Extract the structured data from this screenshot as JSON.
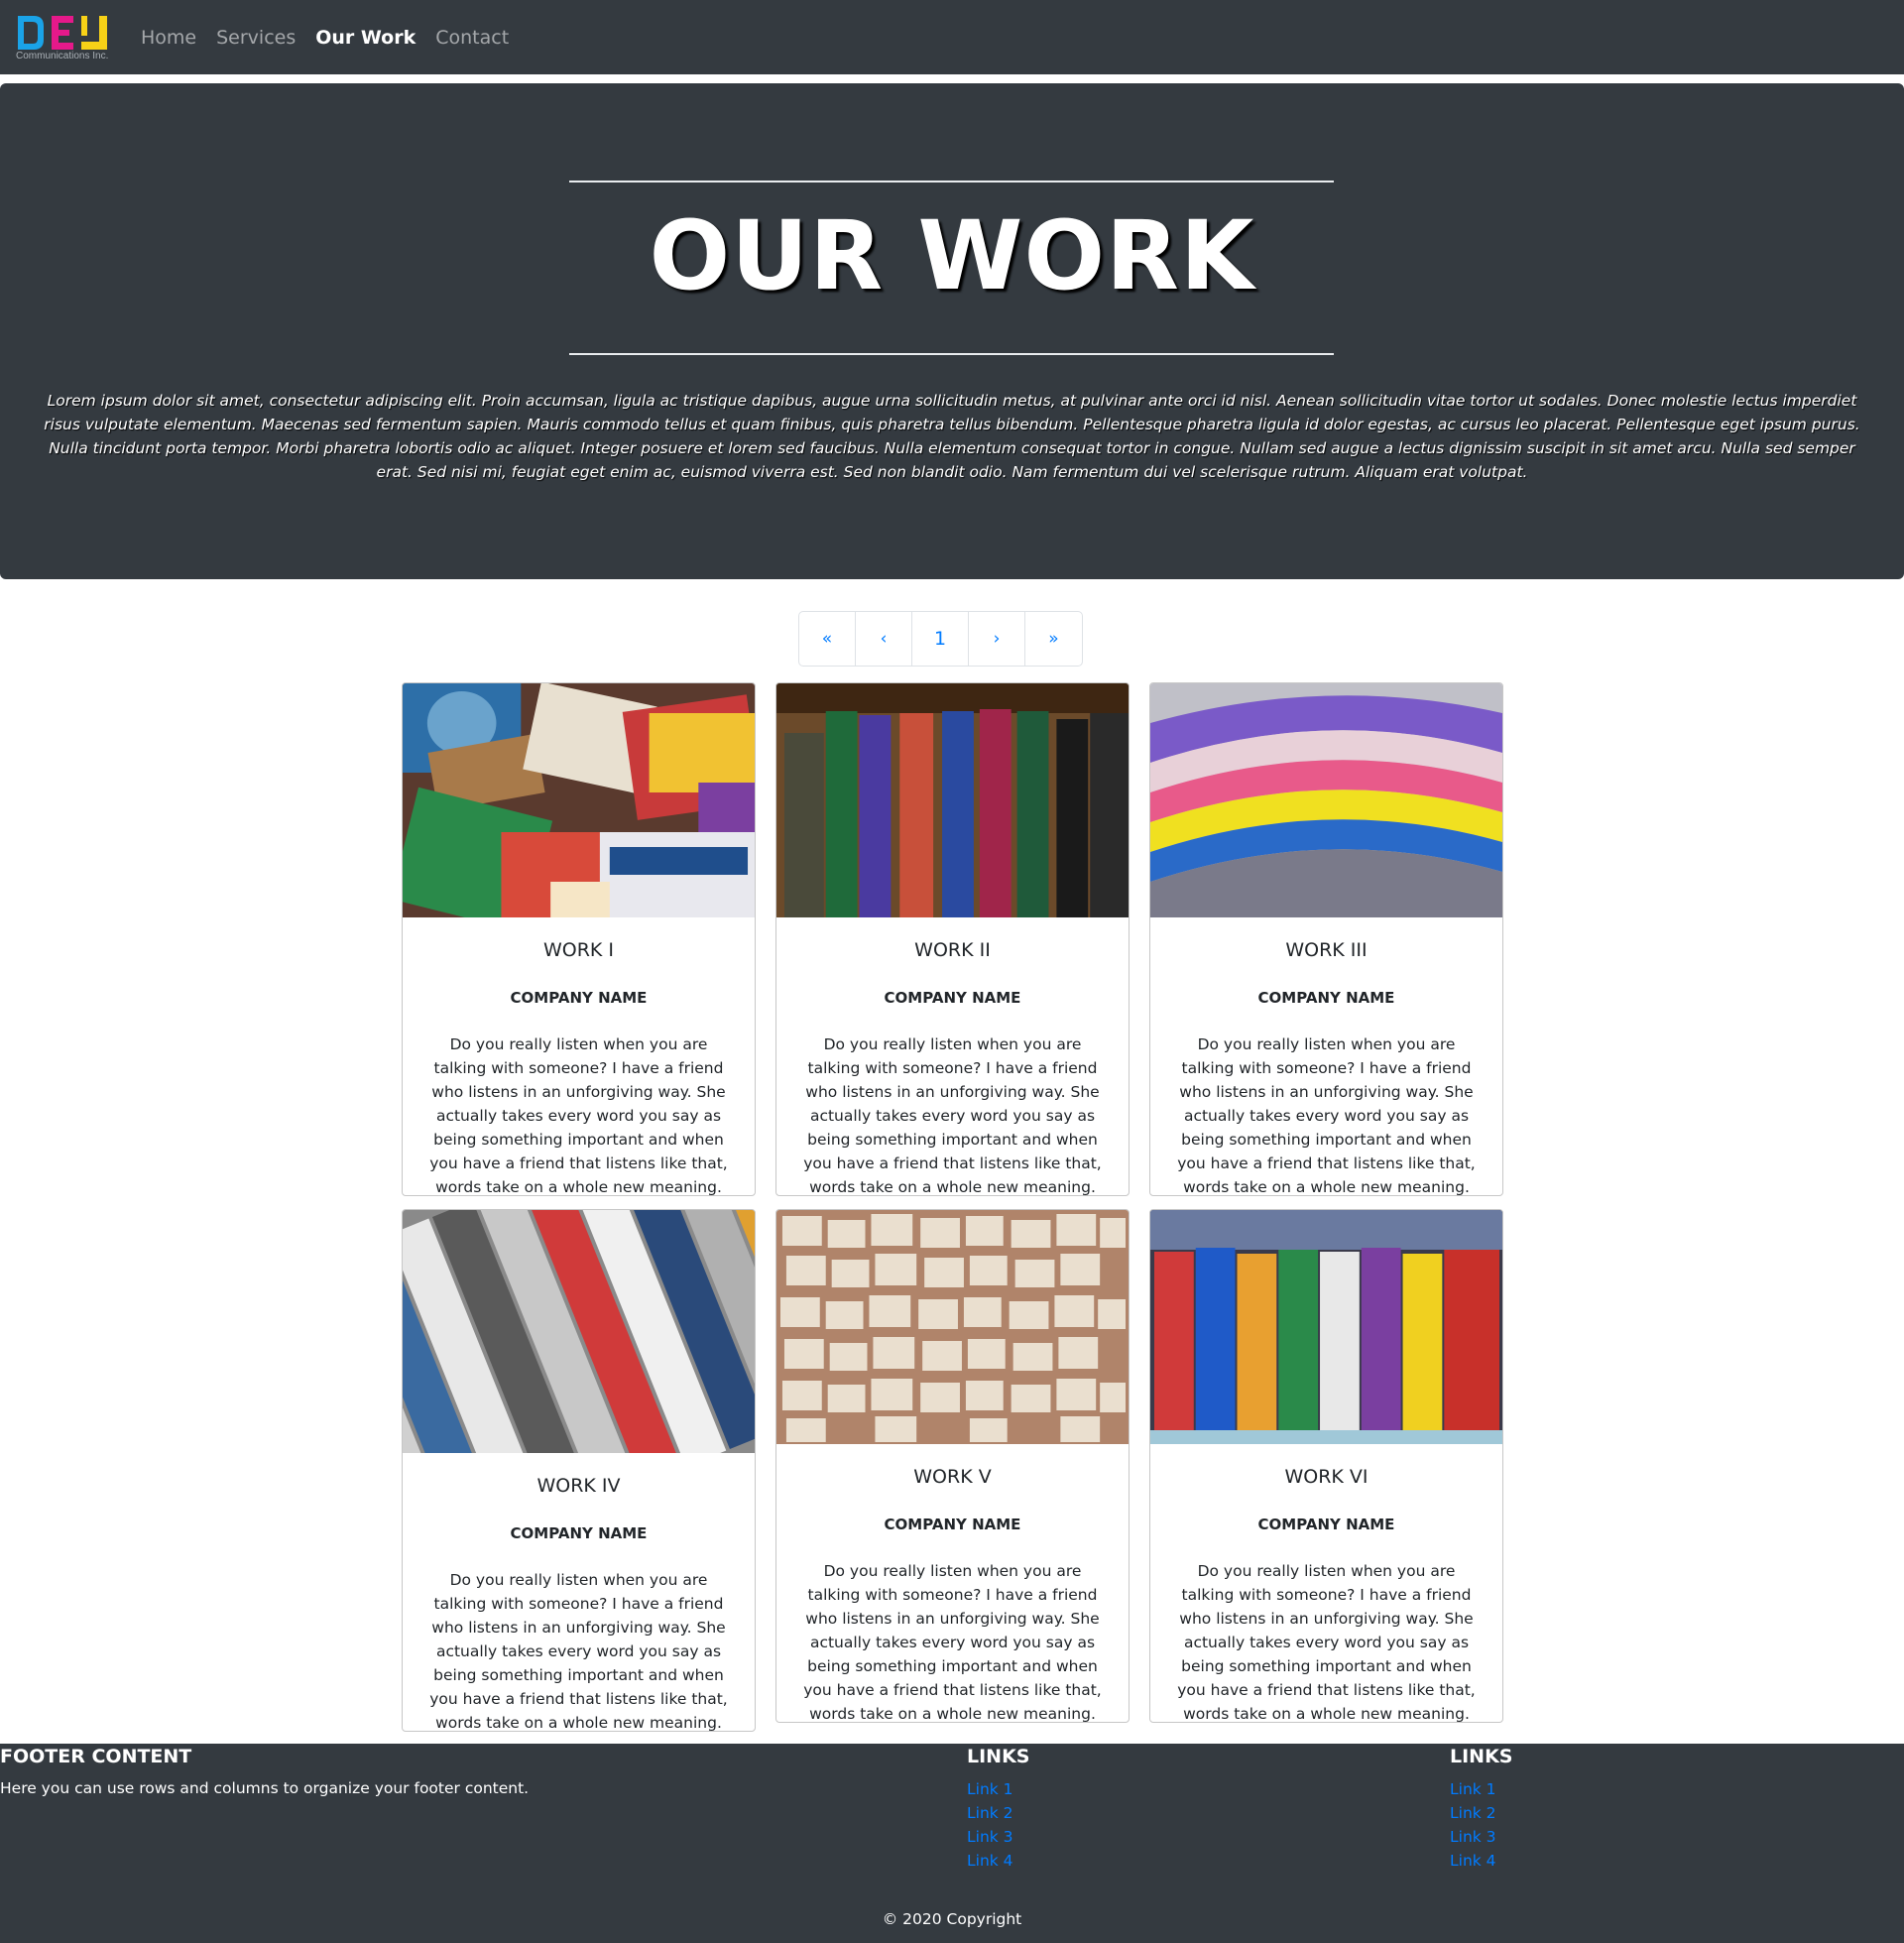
{
  "brand": {
    "subtitle": "Communications Inc.",
    "colors": {
      "cyan": "#1aa3e8",
      "magenta": "#e5198a",
      "yellow": "#f7d117"
    }
  },
  "nav": {
    "items": [
      {
        "label": "Home",
        "active": false
      },
      {
        "label": "Services",
        "active": false
      },
      {
        "label": "Our Work",
        "active": true
      },
      {
        "label": "Contact",
        "active": false
      }
    ]
  },
  "hero": {
    "title": "OUR WORK",
    "text": "Lorem ipsum dolor sit amet, consectetur adipiscing elit. Proin accumsan, ligula ac tristique dapibus, augue urna sollicitudin metus, at pulvinar ante orci id nisl. Aenean sollicitudin vitae tortor ut sodales. Donec molestie lectus imperdiet risus vulputate elementum. Maecenas sed fermentum sapien. Mauris commodo tellus et quam finibus, quis pharetra tellus bibendum. Pellentesque pharetra ligula id dolor egestas, ac cursus leo placerat. Pellentesque eget ipsum purus. Nulla tincidunt porta tempor. Morbi pharetra lobortis odio ac aliquet. Integer posuere et lorem sed faucibus. Nulla elementum consequat tortor in congue. Nullam sed augue a lectus dignissim suscipit in sit amet arcu. Nulla sed semper erat. Sed nisi mi, feugiat eget enim ac, euismod viverra est. Sed non blandit odio. Nam fermentum dui vel scelerisque rutrum. Aliquam erat volutpat."
  },
  "pagination": {
    "first": "«",
    "prev": "‹",
    "current": "1",
    "next": "›",
    "last": "»"
  },
  "cards": [
    {
      "title": "WORK I",
      "company": "COMPANY NAME",
      "desc": "Do you really listen when you are talking with someone? I have a friend who listens in an unforgiving way. She actually takes every word you say as being something important and when you have a friend that listens like that, words take on a whole new meaning.",
      "image": "magazines-and-coffee"
    },
    {
      "title": "WORK II",
      "company": "COMPANY NAME",
      "desc": "Do you really listen when you are talking with someone? I have a friend who listens in an unforgiving way. She actually takes every word you say as being something important and when you have a friend that listens like that, words take on a whole new meaning.",
      "image": "bookshelf"
    },
    {
      "title": "WORK III",
      "company": "COMPANY NAME",
      "desc": "Do you really listen when you are talking with someone? I have a friend who listens in an unforgiving way. She actually takes every word you say as being something important and when you have a friend that listens like that, words take on a whole new meaning.",
      "image": "stacked-magazines"
    },
    {
      "title": "WORK IV",
      "company": "COMPANY NAME",
      "desc": "Do you really listen when you are talking with someone? I have a friend who listens in an unforgiving way. She actually takes every word you say as being something important and when you have a friend that listens like that, words take on a whole new meaning.",
      "image": "rolled-newspapers"
    },
    {
      "title": "WORK V",
      "company": "COMPANY NAME",
      "desc": "Do you really listen when you are talking with someone? I have a friend who listens in an unforgiving way. She actually takes every word you say as being something important and when you have a friend that listens like that, words take on a whole new meaning.",
      "image": "open-books"
    },
    {
      "title": "WORK VI",
      "company": "COMPANY NAME",
      "desc": "Do you really listen when you are talking with someone? I have a friend who listens in an unforgiving way. She actually takes every word you say as being something important and when you have a friend that listens like that, words take on a whole new meaning.",
      "image": "magazine-rack"
    }
  ],
  "footer": {
    "heading": "FOOTER CONTENT",
    "text": "Here you can use rows and columns to organize your footer content.",
    "columns": [
      {
        "heading": "LINKS",
        "links": [
          "Link 1",
          "Link 2",
          "Link 3",
          "Link 4"
        ]
      },
      {
        "heading": "LINKS",
        "links": [
          "Link 1",
          "Link 2",
          "Link 3",
          "Link 4"
        ]
      }
    ],
    "copyright": "© 2020 Copyright"
  },
  "colors": {
    "dark": "#343a40",
    "link": "#007bff",
    "border": "#dee2e6"
  }
}
